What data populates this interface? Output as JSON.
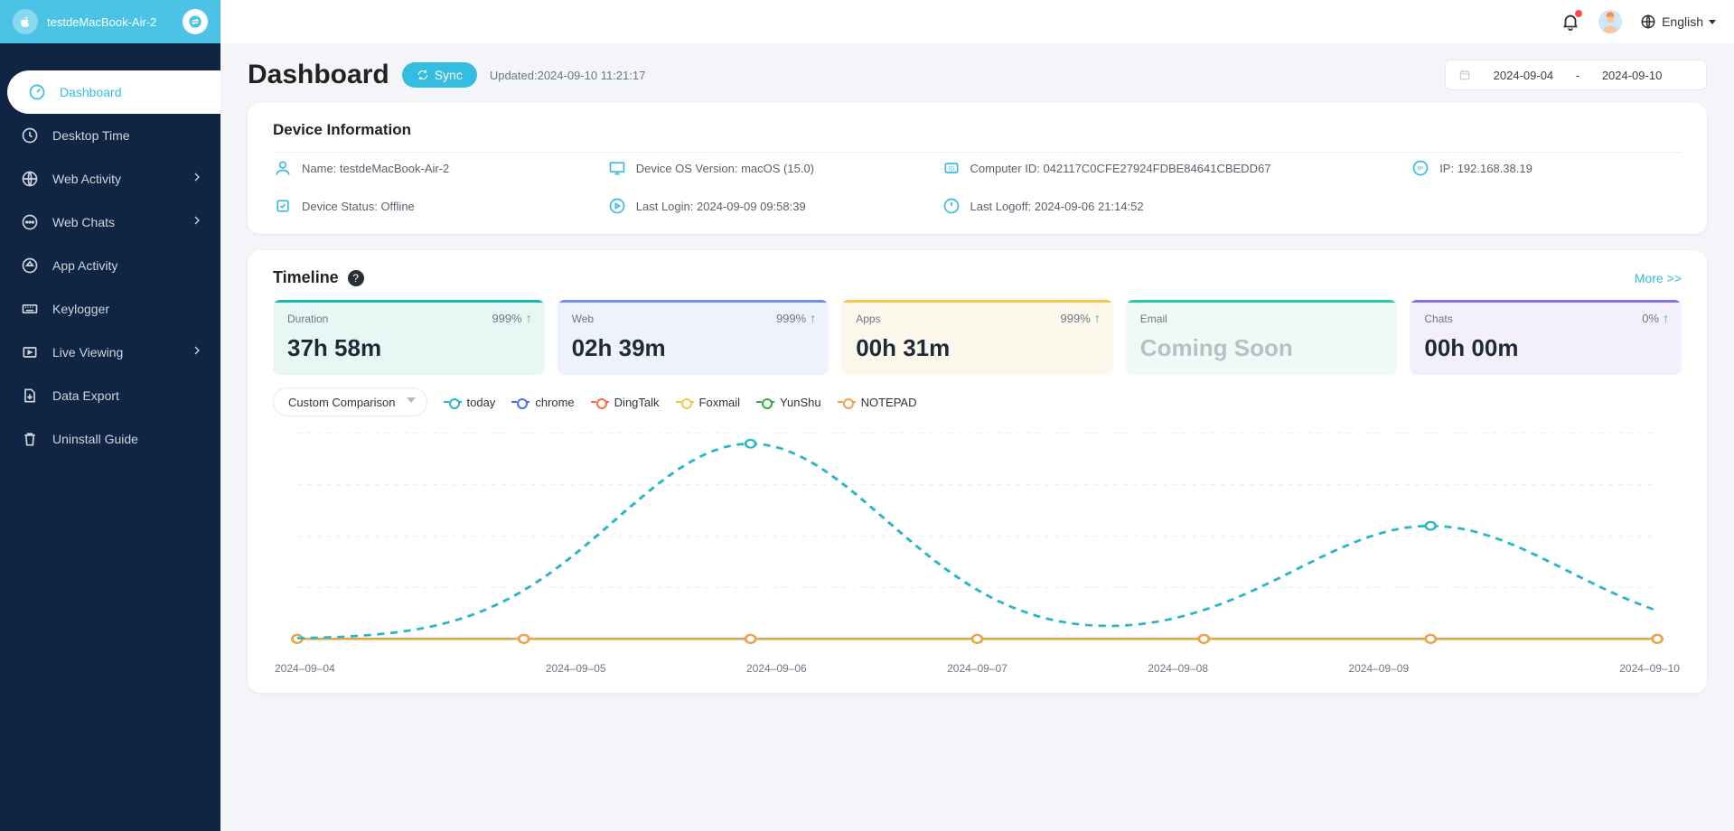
{
  "header": {
    "device_title": "testdeMacBook-Air-2",
    "language": "English"
  },
  "sidebar": {
    "items": [
      {
        "label": "Dashboard",
        "active": true
      },
      {
        "label": "Desktop Time"
      },
      {
        "label": "Web Activity",
        "chev": true
      },
      {
        "label": "Web Chats",
        "chev": true
      },
      {
        "label": "App Activity"
      },
      {
        "label": "Keylogger"
      },
      {
        "label": "Live Viewing",
        "chev": true
      },
      {
        "label": "Data Export"
      },
      {
        "label": "Uninstall Guide"
      }
    ]
  },
  "page": {
    "title": "Dashboard",
    "sync_label": "Sync",
    "updated_prefix": "Updated:",
    "updated_value": "2024-09-10 11:21:17",
    "date_from": "2024-09-04",
    "date_sep": "-",
    "date_to": "2024-09-10"
  },
  "device": {
    "section_title": "Device Information",
    "name_label": "Name: ",
    "name": "testdeMacBook-Air-2",
    "os_label": "Device OS Version: ",
    "os": "macOS (15.0)",
    "id_label": "Computer ID: ",
    "id": "042117C0CFE27924FDBE84641CBEDD67",
    "ip_label": "IP: ",
    "ip": "192.168.38.19",
    "status_label": "Device Status: ",
    "status": "Offline",
    "last_login_label": "Last Login: ",
    "last_login": "2024-09-09 09:58:39",
    "last_logoff_label": "Last Logoff: ",
    "last_logoff": "2024-09-06 21:14:52"
  },
  "timeline": {
    "title": "Timeline",
    "more": "More >>",
    "stats": [
      {
        "label": "Duration",
        "pct": "999%",
        "value": "37h 58m"
      },
      {
        "label": "Web",
        "pct": "999%",
        "value": "02h 39m"
      },
      {
        "label": "Apps",
        "pct": "999%",
        "value": "00h 31m"
      },
      {
        "label": "Email",
        "value": "Coming Soon"
      },
      {
        "label": "Chats",
        "pct": "0%",
        "value": "00h 00m"
      }
    ],
    "compare_label": "Custom Comparison",
    "legend": [
      {
        "name": "today",
        "color": "#28b7c9"
      },
      {
        "name": "chrome",
        "color": "#4b6fe6"
      },
      {
        "name": "DingTalk",
        "color": "#ff6a3b"
      },
      {
        "name": "Foxmail",
        "color": "#f3c54b"
      },
      {
        "name": "YunShu",
        "color": "#28b04a"
      },
      {
        "name": "NOTEPAD",
        "color": "#f2a24a"
      }
    ]
  },
  "chart_data": {
    "type": "line",
    "categories": [
      "2024-09-04",
      "2024-09-05",
      "2024-09-06",
      "2024-09-07",
      "2024-09-08",
      "2024-09-09",
      "2024-09-10"
    ],
    "ylim": [
      0,
      100
    ],
    "series": [
      {
        "name": "today",
        "color": "#28b7c9",
        "values": [
          0,
          0,
          95,
          0,
          0,
          55,
          0
        ]
      },
      {
        "name": "chrome",
        "color": "#4b6fe6",
        "values": [
          0,
          0,
          0,
          0,
          0,
          0,
          0
        ]
      },
      {
        "name": "DingTalk",
        "color": "#ff6a3b",
        "values": [
          0,
          0,
          0,
          0,
          0,
          0,
          0
        ]
      },
      {
        "name": "Foxmail",
        "color": "#f3c54b",
        "values": [
          0,
          0,
          0,
          0,
          0,
          0,
          0
        ]
      },
      {
        "name": "YunShu",
        "color": "#28b04a",
        "values": [
          0,
          0,
          0,
          0,
          0,
          0,
          0
        ]
      },
      {
        "name": "NOTEPAD",
        "color": "#f2a24a",
        "values": [
          0,
          0,
          0,
          0,
          0,
          0,
          0
        ]
      }
    ]
  }
}
